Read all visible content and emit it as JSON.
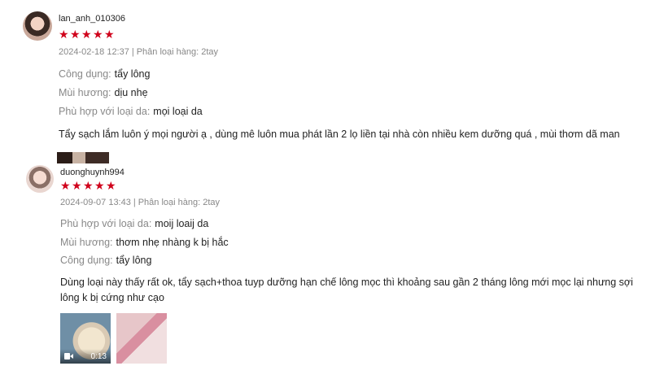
{
  "reviews": [
    {
      "username": "lan_anh_010306",
      "rating": 5,
      "date": "2024-02-18 12:37",
      "separator": "|",
      "variant_label": "Phân loại hàng: 2tay",
      "attributes": [
        {
          "key": "Công dụng:",
          "value": "tẩy lông"
        },
        {
          "key": "Mùi hương:",
          "value": "dịu nhẹ"
        },
        {
          "key": "Phù hợp với loại da:",
          "value": "mọi loại da"
        }
      ],
      "comment": "Tẩy sạch lắm luôn ý mọi người ạ , dùng mê luôn mua phát lần 2 lọ liền tại nhà còn nhiều kem dưỡng quá , mùi thơm dã man"
    },
    {
      "username": "duonghuynh994",
      "rating": 5,
      "date": "2024-09-07 13:43",
      "separator": "|",
      "variant_label": "Phân loại hàng: 2tay",
      "attributes": [
        {
          "key": "Phù hợp với loại da:",
          "value": "moij loaij da"
        },
        {
          "key": "Mùi hương:",
          "value": "thơm nhẹ nhàng k bị hắc"
        },
        {
          "key": "Công dụng:",
          "value": "tẩy lông"
        }
      ],
      "comment": "Dùng loại này thấy rất ok, tẩy sạch+thoa tuyp dưỡng hạn chế lông mọc thì khoảng sau gần 2 tháng lông mới mọc lại nhưng sợi lông k bị cứng như cạo",
      "media": [
        {
          "type": "video",
          "duration": "0:13",
          "icon": "video-camera-icon"
        },
        {
          "type": "image"
        }
      ]
    }
  ],
  "colors": {
    "star": "#d0011b",
    "muted": "#888888",
    "text": "#222222"
  }
}
